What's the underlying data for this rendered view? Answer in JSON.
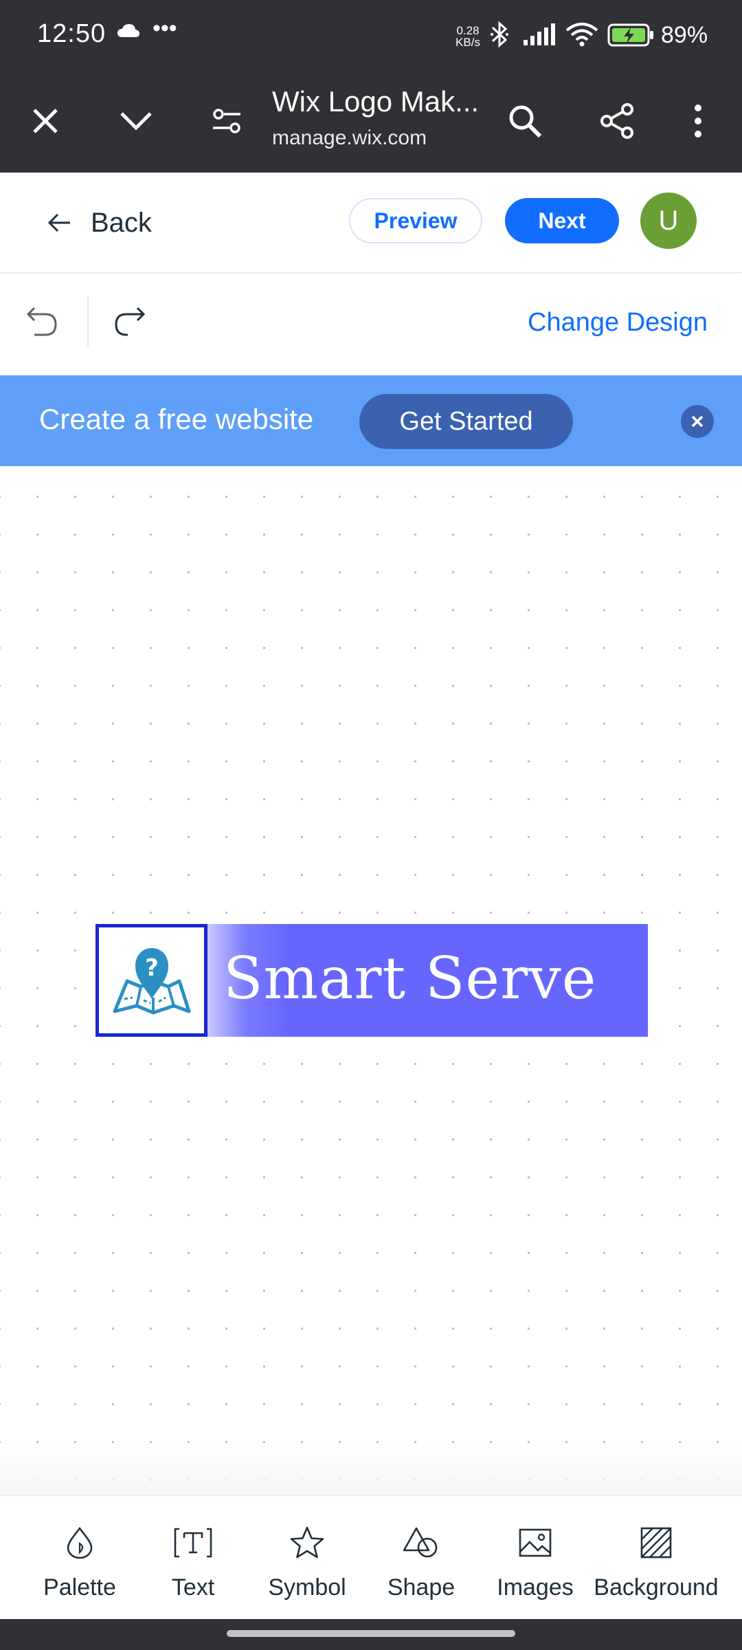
{
  "status_bar": {
    "time": "12:50",
    "more": "•••",
    "net_speed_value": "0.28",
    "net_speed_unit": "KB/s",
    "battery": "89%"
  },
  "browser": {
    "title": "Wix Logo Mak...",
    "url": "manage.wix.com"
  },
  "header": {
    "back_label": "Back",
    "preview_label": "Preview",
    "next_label": "Next",
    "avatar_initial": "U"
  },
  "toolbar": {
    "change_design_label": "Change Design"
  },
  "promo": {
    "text": "Create a free website",
    "cta_label": "Get Started"
  },
  "logo": {
    "text": "Smart Serve"
  },
  "bottom_nav": {
    "items": [
      {
        "label": "Palette",
        "icon": "palette-icon"
      },
      {
        "label": "Text",
        "icon": "text-icon"
      },
      {
        "label": "Symbol",
        "icon": "symbol-icon"
      },
      {
        "label": "Shape",
        "icon": "shape-icon"
      },
      {
        "label": "Images",
        "icon": "images-icon"
      },
      {
        "label": "Background",
        "icon": "background-icon"
      }
    ]
  },
  "colors": {
    "accent": "#116dff",
    "promo_bg": "#5f9ff8",
    "promo_cta": "#3a62b0",
    "avatar": "#6b9e35",
    "logo_band": "#6666ff",
    "logo_icon_border": "#1a24d6",
    "logo_icon": "#2b8fc4"
  }
}
